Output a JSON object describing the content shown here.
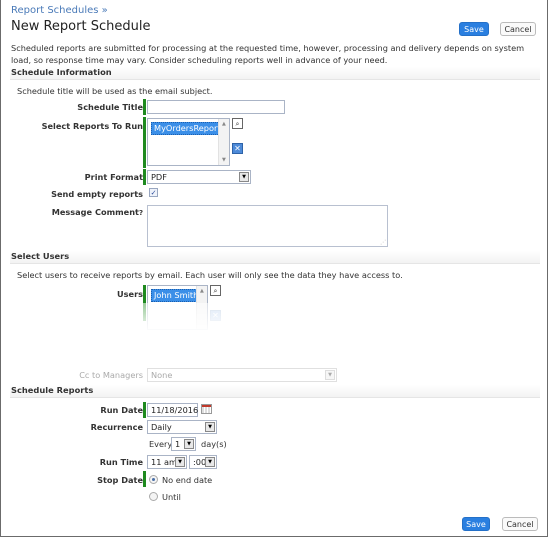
{
  "header": {
    "breadcrumb": "Report Schedules »",
    "title": "New Report Schedule",
    "save_label": "Save",
    "cancel_label": "Cancel"
  },
  "intro": "Scheduled reports are submitted for processing at the requested time, however, processing and delivery depends on system load, so response time may vary. Consider scheduling reports well in advance of your need.",
  "schedule_info": {
    "heading": "Schedule Information",
    "hint": "Schedule title will be used as the email subject.",
    "title_label": "Schedule Title",
    "title_value": "",
    "reports_label": "Select Reports To Run",
    "reports_selected": [
      "MyOrdersReport"
    ],
    "print_format_label": "Print Format",
    "print_format_value": "PDF",
    "send_empty_label": "Send empty reports",
    "send_empty_checked": true,
    "message_comment_label": "Message Comment",
    "message_comment_value": "",
    "help_icon": "?"
  },
  "select_users": {
    "heading": "Select Users",
    "hint": "Select users to receive reports by email. Each user will only see the data they have access to.",
    "users_label": "Users",
    "users_selected": [
      "John Smith"
    ],
    "cc_label": "Cc to Managers",
    "cc_value": "None"
  },
  "schedule_reports": {
    "heading": "Schedule Reports",
    "run_date_label": "Run Date",
    "run_date_value": "11/18/2016",
    "recurrence_label": "Recurrence",
    "recurrence_value": "Daily",
    "every_label": "Every",
    "every_value": "1",
    "every_unit": "day(s)",
    "run_time_label": "Run Time",
    "run_time_hour": "11 am",
    "run_time_minute": ":00",
    "stop_date_label": "Stop Date",
    "stop_options": [
      {
        "label": "No end date",
        "selected": true
      },
      {
        "label": "Until",
        "selected": false
      }
    ]
  },
  "footer": {
    "save_label": "Save",
    "cancel_label": "Cancel"
  },
  "colors": {
    "primary_button": "#2a7fe0",
    "link": "#4a7ab8",
    "required_bar": "#1f8a1f",
    "selection": "#3b8fe8"
  }
}
